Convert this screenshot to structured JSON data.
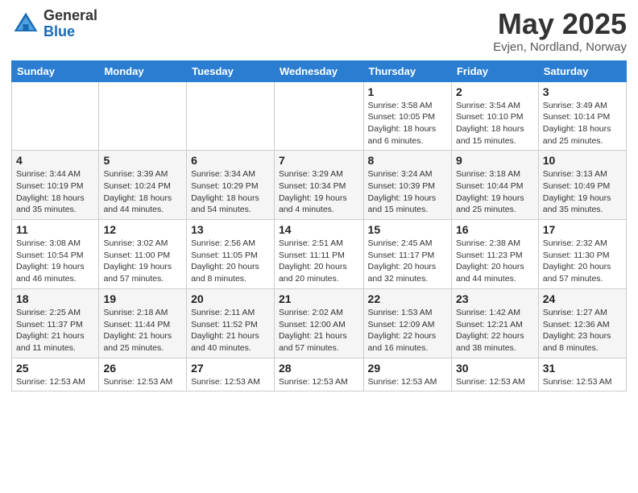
{
  "logo": {
    "general": "General",
    "blue": "Blue"
  },
  "title": {
    "month_year": "May 2025",
    "location": "Evjen, Nordland, Norway"
  },
  "weekdays": [
    "Sunday",
    "Monday",
    "Tuesday",
    "Wednesday",
    "Thursday",
    "Friday",
    "Saturday"
  ],
  "weeks": [
    [
      {
        "day": "",
        "info": ""
      },
      {
        "day": "",
        "info": ""
      },
      {
        "day": "",
        "info": ""
      },
      {
        "day": "",
        "info": ""
      },
      {
        "day": "1",
        "info": "Sunrise: 3:58 AM\nSunset: 10:05 PM\nDaylight: 18 hours\nand 6 minutes."
      },
      {
        "day": "2",
        "info": "Sunrise: 3:54 AM\nSunset: 10:10 PM\nDaylight: 18 hours\nand 15 minutes."
      },
      {
        "day": "3",
        "info": "Sunrise: 3:49 AM\nSunset: 10:14 PM\nDaylight: 18 hours\nand 25 minutes."
      }
    ],
    [
      {
        "day": "4",
        "info": "Sunrise: 3:44 AM\nSunset: 10:19 PM\nDaylight: 18 hours\nand 35 minutes."
      },
      {
        "day": "5",
        "info": "Sunrise: 3:39 AM\nSunset: 10:24 PM\nDaylight: 18 hours\nand 44 minutes."
      },
      {
        "day": "6",
        "info": "Sunrise: 3:34 AM\nSunset: 10:29 PM\nDaylight: 18 hours\nand 54 minutes."
      },
      {
        "day": "7",
        "info": "Sunrise: 3:29 AM\nSunset: 10:34 PM\nDaylight: 19 hours\nand 4 minutes."
      },
      {
        "day": "8",
        "info": "Sunrise: 3:24 AM\nSunset: 10:39 PM\nDaylight: 19 hours\nand 15 minutes."
      },
      {
        "day": "9",
        "info": "Sunrise: 3:18 AM\nSunset: 10:44 PM\nDaylight: 19 hours\nand 25 minutes."
      },
      {
        "day": "10",
        "info": "Sunrise: 3:13 AM\nSunset: 10:49 PM\nDaylight: 19 hours\nand 35 minutes."
      }
    ],
    [
      {
        "day": "11",
        "info": "Sunrise: 3:08 AM\nSunset: 10:54 PM\nDaylight: 19 hours\nand 46 minutes."
      },
      {
        "day": "12",
        "info": "Sunrise: 3:02 AM\nSunset: 11:00 PM\nDaylight: 19 hours\nand 57 minutes."
      },
      {
        "day": "13",
        "info": "Sunrise: 2:56 AM\nSunset: 11:05 PM\nDaylight: 20 hours\nand 8 minutes."
      },
      {
        "day": "14",
        "info": "Sunrise: 2:51 AM\nSunset: 11:11 PM\nDaylight: 20 hours\nand 20 minutes."
      },
      {
        "day": "15",
        "info": "Sunrise: 2:45 AM\nSunset: 11:17 PM\nDaylight: 20 hours\nand 32 minutes."
      },
      {
        "day": "16",
        "info": "Sunrise: 2:38 AM\nSunset: 11:23 PM\nDaylight: 20 hours\nand 44 minutes."
      },
      {
        "day": "17",
        "info": "Sunrise: 2:32 AM\nSunset: 11:30 PM\nDaylight: 20 hours\nand 57 minutes."
      }
    ],
    [
      {
        "day": "18",
        "info": "Sunrise: 2:25 AM\nSunset: 11:37 PM\nDaylight: 21 hours\nand 11 minutes."
      },
      {
        "day": "19",
        "info": "Sunrise: 2:18 AM\nSunset: 11:44 PM\nDaylight: 21 hours\nand 25 minutes."
      },
      {
        "day": "20",
        "info": "Sunrise: 2:11 AM\nSunset: 11:52 PM\nDaylight: 21 hours\nand 40 minutes."
      },
      {
        "day": "21",
        "info": "Sunrise: 2:02 AM\nSunset: 12:00 AM\nDaylight: 21 hours\nand 57 minutes."
      },
      {
        "day": "22",
        "info": "Sunrise: 1:53 AM\nSunset: 12:09 AM\nDaylight: 22 hours\nand 16 minutes."
      },
      {
        "day": "23",
        "info": "Sunrise: 1:42 AM\nSunset: 12:21 AM\nDaylight: 22 hours\nand 38 minutes."
      },
      {
        "day": "24",
        "info": "Sunrise: 1:27 AM\nSunset: 12:36 AM\nDaylight: 23 hours\nand 8 minutes."
      }
    ],
    [
      {
        "day": "25",
        "info": "Sunrise: 12:53 AM"
      },
      {
        "day": "26",
        "info": "Sunrise: 12:53 AM"
      },
      {
        "day": "27",
        "info": "Sunrise: 12:53 AM"
      },
      {
        "day": "28",
        "info": "Sunrise: 12:53 AM"
      },
      {
        "day": "29",
        "info": "Sunrise: 12:53 AM"
      },
      {
        "day": "30",
        "info": "Sunrise: 12:53 AM"
      },
      {
        "day": "31",
        "info": "Sunrise: 12:53 AM"
      }
    ]
  ]
}
